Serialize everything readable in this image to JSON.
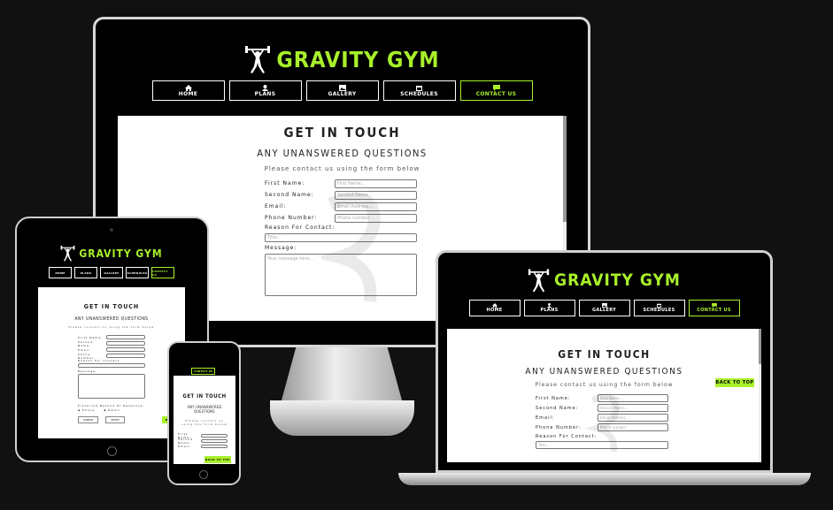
{
  "brand": {
    "name": "GRAVITY GYM",
    "accent": "#a8f02a"
  },
  "nav": [
    {
      "label": "HOME",
      "icon": "home-icon"
    },
    {
      "label": "PLANS",
      "icon": "user-icon"
    },
    {
      "label": "GALLERY",
      "icon": "image-icon"
    },
    {
      "label": "SCHEDULES",
      "icon": "calendar-icon"
    },
    {
      "label": "CONTACT US",
      "icon": "chat-icon",
      "active": true
    }
  ],
  "contact": {
    "title": "GET IN TOUCH",
    "subtitle": "ANY UNANSWERED QUESTIONS",
    "intro": "Please contact us using the form below",
    "fields": {
      "first_name": {
        "label": "First Name:",
        "placeholder": "First Name..."
      },
      "second_name": {
        "label": "Second Name:",
        "placeholder": "Second Name..."
      },
      "email": {
        "label": "Email:",
        "placeholder": "Email Address..."
      },
      "phone": {
        "label": "Phone Number:",
        "placeholder": "Phone number"
      },
      "reason": {
        "label": "Reason For Contact:",
        "placeholder": "Title..."
      },
      "message": {
        "label": "Message:",
        "placeholder": "Your message here..."
      }
    },
    "preferred_label": "Preferred Method Of Response:",
    "pref_options": [
      "Phone",
      "Email"
    ],
    "submit_label": "SUBMIT",
    "reset_label": "RESET"
  },
  "back_to_top": "BACK TO TOP"
}
